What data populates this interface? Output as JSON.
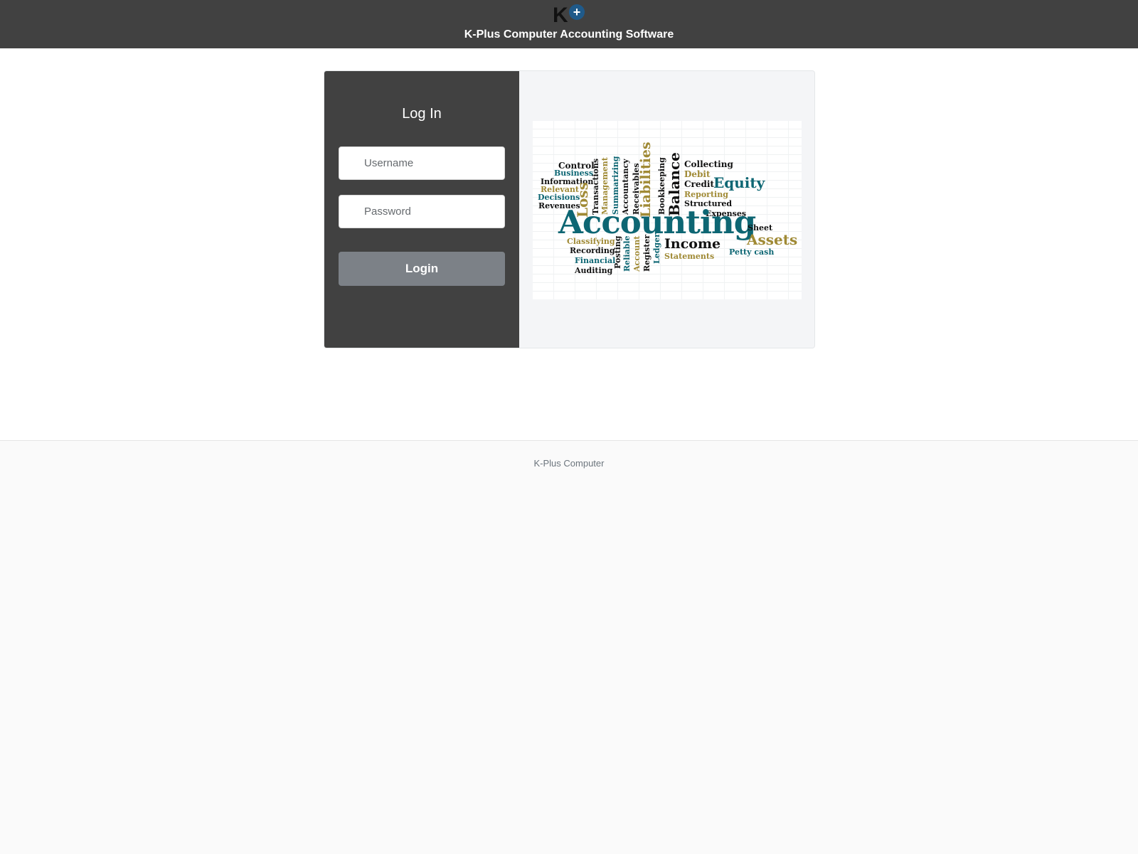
{
  "header": {
    "logo": {
      "letter": "K",
      "plus": "+",
      "colors": {
        "letter": "#111111",
        "circle": "#1f5a8a",
        "plus": "#ffffff"
      }
    },
    "title": "K-Plus Computer Accounting Software"
  },
  "login": {
    "heading": "Log In",
    "username_placeholder": "Username",
    "password_placeholder": "Password",
    "button_label": "Login"
  },
  "wordcloud": {
    "main": "Accounting",
    "words": {
      "control": "Control",
      "business": "Business",
      "information": "Information",
      "relevant": "Relevant",
      "decisions": "Decisions",
      "revenues": "Revenues",
      "loss": "Loss",
      "transactions": "Transactions",
      "management": "Management",
      "summarizing": "Summarizing",
      "accountancy": "Accountancy",
      "receivables": "Receivables",
      "liabilities": "Liabilities",
      "bookkeeping": "Bookkeeping",
      "balance": "Balance",
      "collecting": "Collecting",
      "debit": "Debit",
      "credit": "Credit",
      "equity": "Equity",
      "reporting": "Reporting",
      "structured": "Structured",
      "expenses": "Expenses",
      "sheet": "Sheet",
      "assets": "Assets",
      "petty_cash": "Petty cash",
      "income": "Income",
      "statements": "Statements",
      "classifying": "Classifying",
      "recording": "Recording",
      "financial": "Financial",
      "auditing": "Auditing",
      "posting": "Posting",
      "reliable": "Reliable",
      "account": "Account",
      "register": "Register",
      "ledger": "Ledger"
    }
  },
  "footer": {
    "text": "K-Plus Computer"
  },
  "colors": {
    "header_bg": "#414141",
    "login_panel_bg": "#414141",
    "button_bg": "#7c8187",
    "teal": "#0d6673",
    "gold": "#a08a35"
  }
}
